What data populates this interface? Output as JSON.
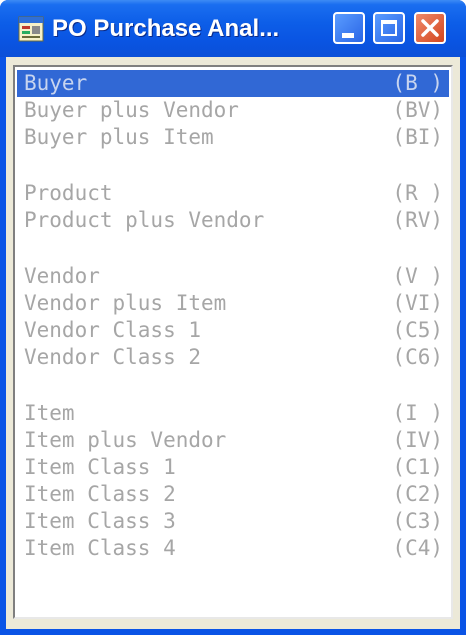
{
  "window": {
    "title": "PO Purchase Anal...",
    "app_icon": "window-app-icon",
    "controls": {
      "minimize": "minimize-icon",
      "maximize": "maximize-icon",
      "close": "close-icon"
    },
    "colors": {
      "titlebar": "#0a55e3",
      "selection": "#3168d5",
      "item_text": "#a6a6a6",
      "close_button": "#d3461f"
    }
  },
  "list": {
    "selected_index": 0,
    "items": [
      {
        "label": "Buyer",
        "code": "(B )"
      },
      {
        "label": "Buyer plus Vendor",
        "code": "(BV)"
      },
      {
        "label": "Buyer plus Item",
        "code": "(BI)"
      },
      {
        "label": "Product",
        "code": "(R )"
      },
      {
        "label": "Product plus Vendor",
        "code": "(RV)"
      },
      {
        "label": "Vendor",
        "code": "(V )"
      },
      {
        "label": "Vendor plus Item",
        "code": "(VI)"
      },
      {
        "label": "Vendor Class 1",
        "code": "(C5)"
      },
      {
        "label": "Vendor Class 2",
        "code": "(C6)"
      },
      {
        "label": "Item",
        "code": "(I )"
      },
      {
        "label": "Item plus Vendor",
        "code": "(IV)"
      },
      {
        "label": "Item Class 1",
        "code": "(C1)"
      },
      {
        "label": "Item Class 2",
        "code": "(C2)"
      },
      {
        "label": "Item Class 3",
        "code": "(C3)"
      },
      {
        "label": "Item Class 4",
        "code": "(C4)"
      }
    ]
  }
}
